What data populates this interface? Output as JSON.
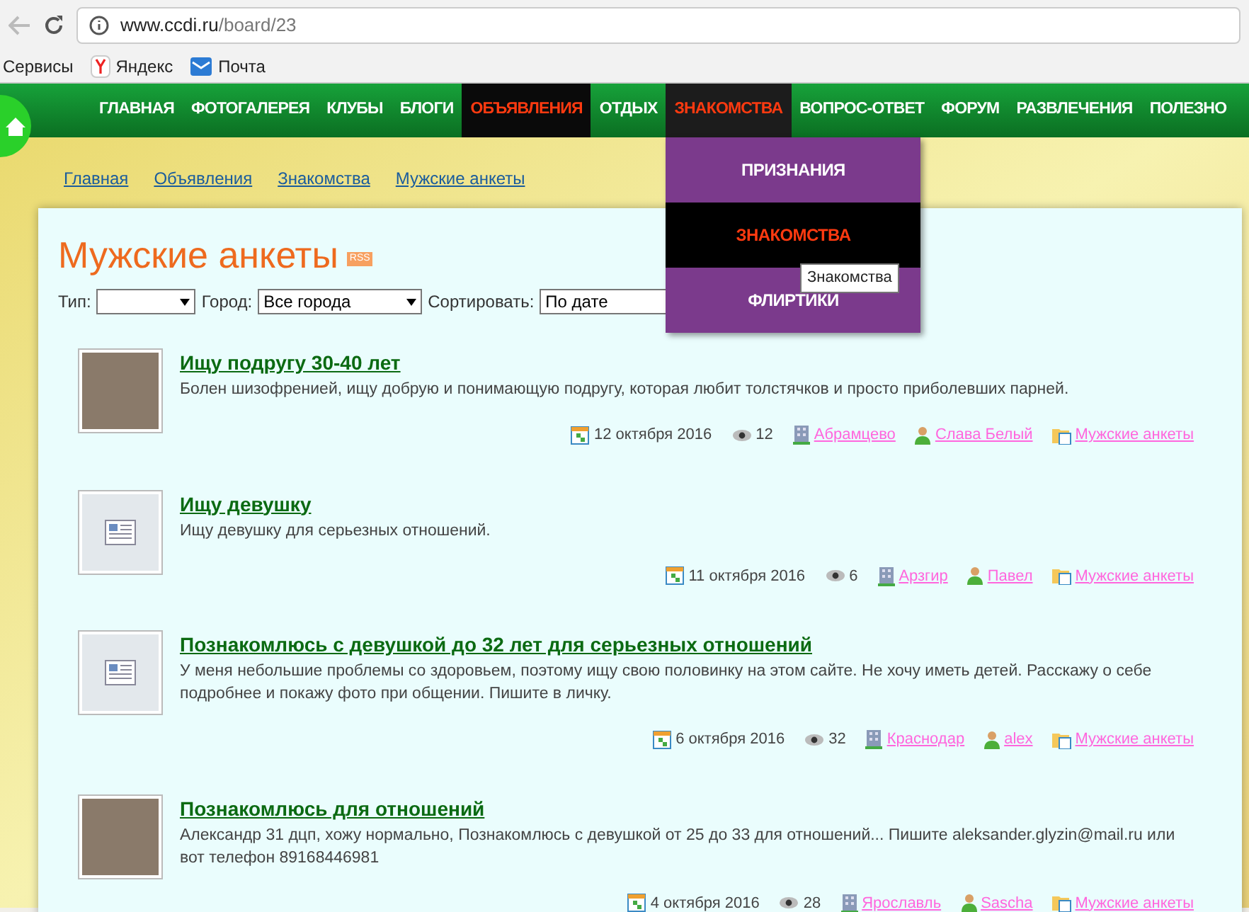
{
  "browser": {
    "url_host": "www.ccdi.ru",
    "url_path": "/board/23",
    "bookmarks": [
      {
        "label": "Сервисы",
        "kind": "apps"
      },
      {
        "label": "Яндекс",
        "kind": "yandex"
      },
      {
        "label": "Почта",
        "kind": "mail"
      }
    ]
  },
  "nav": [
    {
      "label": "ГЛАВНАЯ",
      "selected": false,
      "expanded": false
    },
    {
      "label": "ФОТОГАЛЕРЕЯ",
      "selected": false,
      "expanded": false
    },
    {
      "label": "КЛУБЫ",
      "selected": false,
      "expanded": false
    },
    {
      "label": "БЛОГИ",
      "selected": false,
      "expanded": false
    },
    {
      "label": "ОБЪЯВЛЕНИЯ",
      "selected": true,
      "expanded": false
    },
    {
      "label": "ОТДЫХ",
      "selected": false,
      "expanded": false
    },
    {
      "label": "ЗНАКОМСТВА",
      "selected": false,
      "expanded": true,
      "submenu": [
        {
          "label": "ПРИЗНАНИЯ",
          "hovered": false
        },
        {
          "label": "ЗНАКОМСТВА",
          "hovered": true
        },
        {
          "label": "ФЛИРТИКИ",
          "hovered": false
        }
      ]
    },
    {
      "label": "ВОПРОС-ОТВЕТ",
      "selected": false,
      "expanded": false
    },
    {
      "label": "ФОРУМ",
      "selected": false,
      "expanded": false
    },
    {
      "label": "РАЗВЛЕЧЕНИЯ",
      "selected": false,
      "expanded": false
    },
    {
      "label": "ПОЛЕЗНО",
      "selected": false,
      "expanded": false
    }
  ],
  "tooltip": "Знакомства",
  "breadcrumbs": [
    "Главная",
    "Объявления",
    "Знакомства",
    "Мужские анкеты"
  ],
  "page_title": "Мужские анкеты",
  "rss_badge": "RSS",
  "filters": {
    "type_label": "Тип:",
    "city_label": "Город:",
    "city_value": "Все города",
    "sort_label": "Сортировать:",
    "sort_value": "По дате"
  },
  "listings": [
    {
      "title": "Ищу подругу 30-40 лет",
      "kind": "photo",
      "text": "Болен шизофренией, ищу добрую и понимающую подругу, которая любит толстячков и просто приболевших парней.",
      "date": "12 октября 2016",
      "views": "12",
      "city": "Абрамцево",
      "author": "Слава Белый",
      "category": "Мужские анкеты"
    },
    {
      "title": "Ищу девушку",
      "kind": "none",
      "text": "Ищу девушку для серьезных отношений.",
      "date": "11 октября 2016",
      "views": "6",
      "city": "Арзгир",
      "author": "Павел",
      "category": "Мужские анкеты"
    },
    {
      "title": "Познакомлюсь с девушкой до 32 лет для серьезных отношений",
      "kind": "none",
      "text": "У меня небольшие проблемы со здоровьем, поэтому ищу свою половинку на этом сайте. Не хочу иметь детей. Расскажу о себе подробнее и покажу фото при общении. Пишите в личку.",
      "date": "6 октября 2016",
      "views": "32",
      "city": "Краснодар",
      "author": "alex",
      "category": "Мужские анкеты"
    },
    {
      "title": "Познакомлюсь для отношений",
      "kind": "photo",
      "text": "Александр 31 дцп, хожу нормально, Познакомлюсь с девушкой от 25 до 33 для отношений... Пишите aleksander.glyzin@mail.ru или вот телефон 89168446981",
      "date": "4 октября 2016",
      "views": "28",
      "city": "Ярославль",
      "author": "Sascha",
      "category": "Мужские анкеты"
    }
  ]
}
